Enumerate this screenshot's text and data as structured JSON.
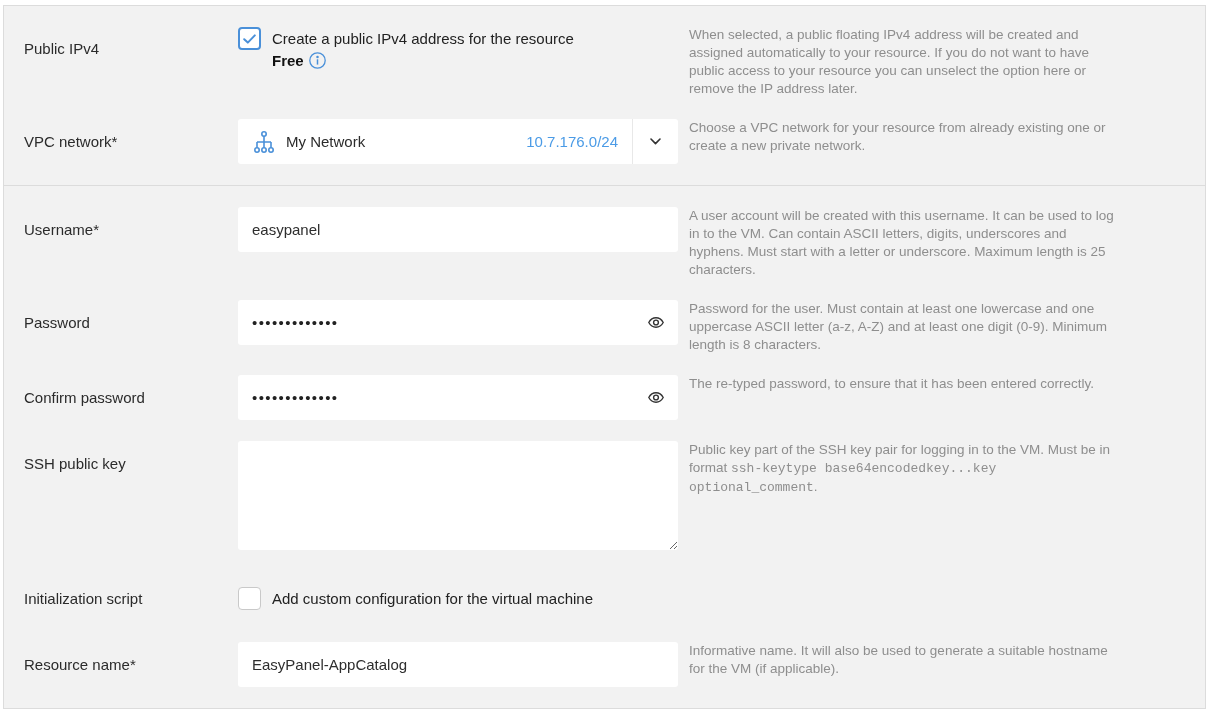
{
  "sections": [
    {
      "rows": [
        {
          "kind": "checkbox",
          "label": "Public IPv4",
          "checked": true,
          "option": "Create a public IPv4 address for the resource",
          "price": "Free",
          "hint": [
            {
              "kind": "text",
              "text": "When selected, a public floating IPv4 address will be created and assigned automatically to your resource. If you do not want to have public access to your resource you can unselect the option here or remove the IP address later."
            }
          ]
        },
        {
          "kind": "select",
          "label": "VPC network*",
          "value": "My Network",
          "subnet": "10.7.176.0/24",
          "hint": [
            {
              "kind": "text",
              "text": "Choose a VPC network for your resource from already existing one or create a new private network."
            }
          ]
        }
      ]
    },
    {
      "rows": [
        {
          "kind": "text",
          "label": "Username*",
          "value": "easypanel",
          "hint": [
            {
              "kind": "text",
              "text": "A user account will be created with this username. It can be used to log in to the VM. Can contain ASCII letters, digits, underscores and hyphens. Must start with a letter or underscore. Maximum length is 25 characters."
            }
          ]
        },
        {
          "kind": "password",
          "label": "Password",
          "value": "•••••••••••••",
          "hint": [
            {
              "kind": "text",
              "text": "Password for the user. Must contain at least one lowercase and one uppercase ASCII letter (a-z, A-Z) and at least one digit (0-9). Minimum length is 8 characters."
            }
          ]
        },
        {
          "kind": "password",
          "label": "Confirm password",
          "value": "•••••••••••••",
          "hint": [
            {
              "kind": "text",
              "text": "The re-typed password, to ensure that it has been entered correctly."
            }
          ]
        },
        {
          "kind": "textarea",
          "label": "SSH public key",
          "hint": [
            {
              "kind": "text",
              "text": "Public key part of the SSH key pair for logging in to the VM. Must be in format "
            },
            {
              "kind": "code",
              "text": "ssh-keytype base64encodedkey...key optional_comment"
            },
            {
              "kind": "text",
              "text": "."
            }
          ]
        },
        {
          "kind": "checkbox",
          "label": "Initialization script",
          "checked": false,
          "option": "Add custom configuration for the virtual machine"
        },
        {
          "kind": "text",
          "label": "Resource name*",
          "value": "EasyPanel-AppCatalog",
          "hint": [
            {
              "kind": "text",
              "text": "Informative name. It will also be used to generate a suitable hostname for the VM (if applicable)."
            }
          ]
        }
      ]
    }
  ]
}
